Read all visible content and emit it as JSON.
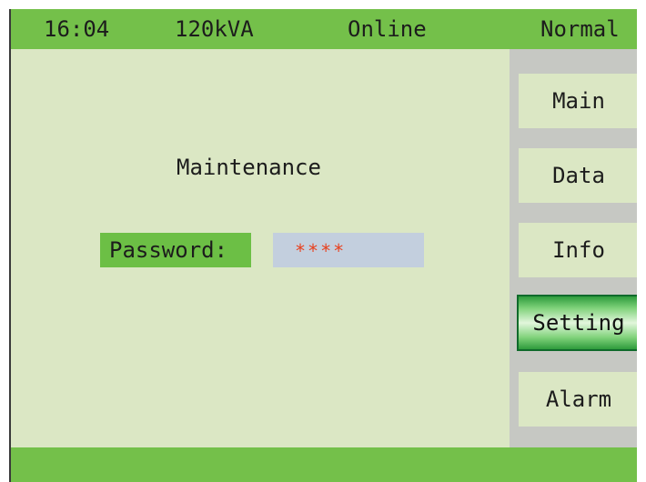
{
  "header": {
    "time": "16:04",
    "capacity": "120kVA",
    "connection": "Online",
    "mode": "Normal"
  },
  "main": {
    "title": "Maintenance",
    "password_label": "Password:",
    "password_value": "****"
  },
  "sidebar": {
    "items": [
      {
        "label": "Main",
        "active": false
      },
      {
        "label": "Data",
        "active": false
      },
      {
        "label": "Info",
        "active": false
      },
      {
        "label": "Setting",
        "active": true
      },
      {
        "label": "Alarm",
        "active": false
      }
    ]
  },
  "colors": {
    "header_bar": "#74c04a",
    "screen_background": "#dbe7c4",
    "sidebar_background": "#c6c8c3",
    "label_background": "#6cbf45",
    "field_background": "#c3cfde",
    "password_text": "#e8411e",
    "active_button": "#2e9b3c"
  }
}
